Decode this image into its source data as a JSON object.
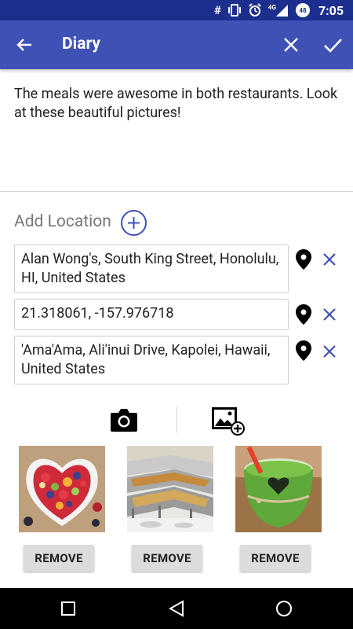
{
  "status_bar": {
    "time": "7:05",
    "network": "4G",
    "battery": "48",
    "icons": [
      "hash-icon",
      "vibrate-icon",
      "alarm-icon",
      "signal-icon",
      "battery-icon"
    ]
  },
  "app_bar": {
    "title": "Diary",
    "back_icon": "arrow-back-icon",
    "close_icon": "close-icon",
    "save_icon": "check-icon"
  },
  "note": {
    "text": "The meals were awesome in both restaurants. Look at these beautiful pictures!"
  },
  "locations": {
    "header": "Add Location",
    "items": [
      {
        "value": "Alan Wong's, South King Street, Honolulu, HI, United States"
      },
      {
        "value": "21.318061, -157.976718"
      },
      {
        "value": "'Ama'Ama, Ali'inui Drive, Kapolei, Hawaii, United States"
      }
    ]
  },
  "media": {
    "camera_icon": "camera-icon",
    "gallery_icon": "add-photo-icon"
  },
  "photos": [
    {
      "subject": "fruit-heart-bowl",
      "remove_label": "REMOVE"
    },
    {
      "subject": "buffet-trays",
      "remove_label": "REMOVE"
    },
    {
      "subject": "green-smoothie",
      "remove_label": "REMOVE"
    }
  ],
  "colors": {
    "status_bar": "#1c2f8f",
    "app_bar": "#3f51b5",
    "accent": "#3f51b5",
    "remove_button": "#dcdcdc"
  }
}
